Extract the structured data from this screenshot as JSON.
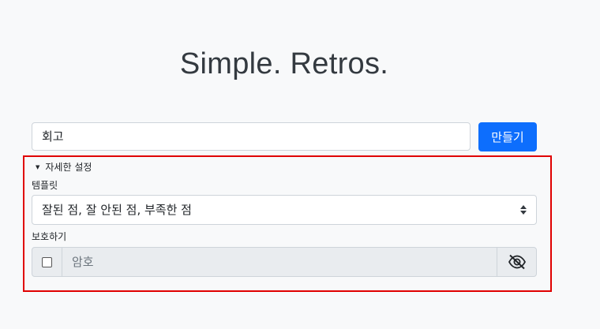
{
  "header": {
    "title": "Simple. Retros."
  },
  "create_form": {
    "retro_name_value": "회고",
    "create_button_label": "만들기"
  },
  "advanced": {
    "summary_label": "자세한 설정",
    "template_label": "템플릿",
    "template_selected": "잘된 점, 잘 안된 점, 부족한 점",
    "protect_label": "보호하기",
    "password_placeholder": "암호",
    "password_checked": false
  },
  "icons": {
    "summary": "caret-down-icon",
    "select": "select-updown-icon",
    "password_toggle": "eye-slash-icon"
  },
  "colors": {
    "primary": "#0d6efd",
    "highlight_border": "#e00000",
    "background": "#f8f9fa"
  }
}
